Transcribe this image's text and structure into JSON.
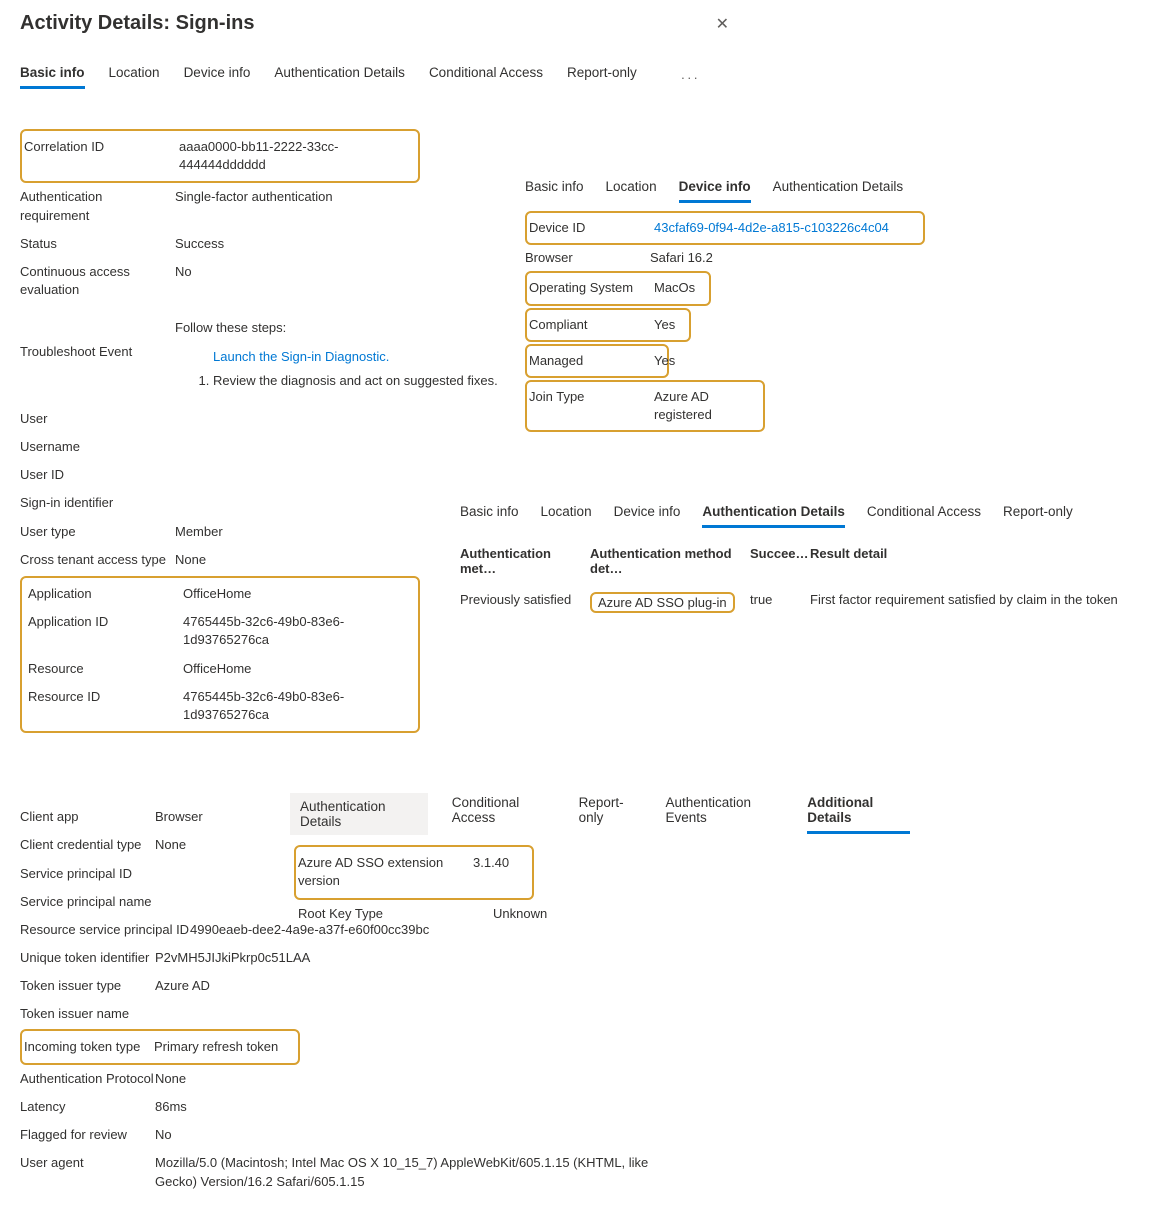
{
  "header": {
    "title": "Activity Details: Sign-ins"
  },
  "main_tabs": [
    "Basic info",
    "Location",
    "Device info",
    "Authentication Details",
    "Conditional Access",
    "Report-only"
  ],
  "main_tabs_more": "···",
  "basic": {
    "correlation_id": {
      "label": "Correlation ID",
      "value": "aaaa0000-bb11-2222-33cc-444444dddddd"
    },
    "auth_req": {
      "label": "Authentication requirement",
      "value": "Single-factor authentication"
    },
    "status": {
      "label": "Status",
      "value": "Success"
    },
    "cae": {
      "label": "Continuous access evaluation",
      "value": "No"
    },
    "troubleshoot": {
      "label": "Troubleshoot Event",
      "intro": "Follow these steps:",
      "link": "Launch the Sign-in Diagnostic.",
      "step1": "Review the diagnosis and act on suggested fixes."
    },
    "user": {
      "label": "User"
    },
    "username": {
      "label": "Username"
    },
    "user_id": {
      "label": "User ID"
    },
    "signin_id": {
      "label": "Sign-in identifier"
    },
    "user_type": {
      "label": "User type",
      "value": "Member"
    },
    "cross_tenant": {
      "label": "Cross tenant access type",
      "value": "None"
    },
    "application": {
      "label": "Application",
      "value": "OfficeHome"
    },
    "app_id": {
      "label": "Application ID",
      "value": "4765445b-32c6-49b0-83e6-1d93765276ca"
    },
    "resource": {
      "label": "Resource",
      "value": "OfficeHome"
    },
    "resource_id": {
      "label": "Resource ID",
      "value": "4765445b-32c6-49b0-83e6-1d93765276ca"
    }
  },
  "device_panel": {
    "tabs": [
      "Basic info",
      "Location",
      "Device info",
      "Authentication Details"
    ],
    "device_id": {
      "label": "Device ID",
      "value": "43cfaf69-0f94-4d2e-a815-c103226c4c04"
    },
    "browser": {
      "label": "Browser",
      "value": "Safari 16.2"
    },
    "os": {
      "label": "Operating System",
      "value": "MacOs"
    },
    "compliant": {
      "label": "Compliant",
      "value": "Yes"
    },
    "managed": {
      "label": "Managed",
      "value": "Yes"
    },
    "join_type": {
      "label": "Join Type",
      "value": "Azure AD registered"
    }
  },
  "auth_panel": {
    "tabs": [
      "Basic info",
      "Location",
      "Device info",
      "Authentication Details",
      "Conditional Access",
      "Report-only"
    ],
    "headers": {
      "method": "Authentication met…",
      "detail": "Authentication method det…",
      "succ": "Succee…",
      "result": "Result detail"
    },
    "row": {
      "method": "Previously satisfied",
      "detail": "Azure AD SSO plug-in",
      "succ": "true",
      "result": "First factor requirement satisfied by claim in the token"
    }
  },
  "lower": {
    "client_app": {
      "label": "Client app",
      "value": "Browser"
    },
    "cred_type": {
      "label": "Client credential type",
      "value": "None"
    },
    "sp_id": {
      "label": "Service principal ID"
    },
    "sp_name": {
      "label": "Service principal name"
    },
    "rsp_id": {
      "label": "Resource service principal ID",
      "value": "4990eaeb-dee2-4a9e-a37f-e60f00cc39bc"
    },
    "uti": {
      "label": "Unique token identifier",
      "value": "P2vMH5JIJkiPkrp0c51LAA"
    },
    "issuer_type": {
      "label": "Token issuer type",
      "value": "Azure AD"
    },
    "issuer_name": {
      "label": "Token issuer name"
    },
    "incoming": {
      "label": "Incoming token type",
      "value": "Primary refresh token"
    },
    "auth_proto": {
      "label": "Authentication Protocol",
      "value": "None"
    },
    "latency": {
      "label": "Latency",
      "value": "86ms"
    },
    "flagged": {
      "label": "Flagged for review",
      "value": "No"
    },
    "ua": {
      "label": "User agent",
      "value": "Mozilla/5.0 (Macintosh; Intel Mac OS X 10_15_7) AppleWebKit/605.1.15 (KHTML, like Gecko) Version/16.2 Safari/605.1.15"
    }
  },
  "add_panel": {
    "tabs": [
      "Authentication Details",
      "Conditional Access",
      "Report-only",
      "Authentication Events",
      "Additional Details"
    ],
    "sso_ver": {
      "label": "Azure AD SSO extension version",
      "value": "3.1.40"
    },
    "root_key": {
      "label": "Root Key Type",
      "value": "Unknown"
    }
  }
}
